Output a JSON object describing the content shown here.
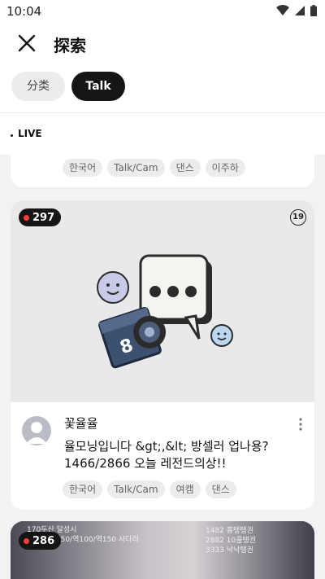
{
  "status_bar": {
    "time": "10:04"
  },
  "header": {
    "title": "探索"
  },
  "chips": {
    "category": "分类",
    "talk": "Talk"
  },
  "section": {
    "live_label": "LIVE"
  },
  "cards": [
    {
      "tags": [
        "한국어",
        "Talk/Cam",
        "댄스",
        "이주하"
      ]
    },
    {
      "viewers": "297",
      "age_rating": "19",
      "streamer": "꽃율율",
      "title": "율모닝입니다 &gt;,&lt; 방셀러 업나용? 1466/2866 오늘 레전드의상!!",
      "tags": [
        "한국어",
        "Talk/Cam",
        "여캠",
        "댄스"
      ]
    },
    {
      "viewers": "286",
      "overlay_lines": [
        "170두산 달성시",
        "별/역50/역100/역150 사다리",
        "1482 흥탱탱권",
        "2882 10콜탱권",
        "3333 낙낙탱권"
      ]
    }
  ]
}
